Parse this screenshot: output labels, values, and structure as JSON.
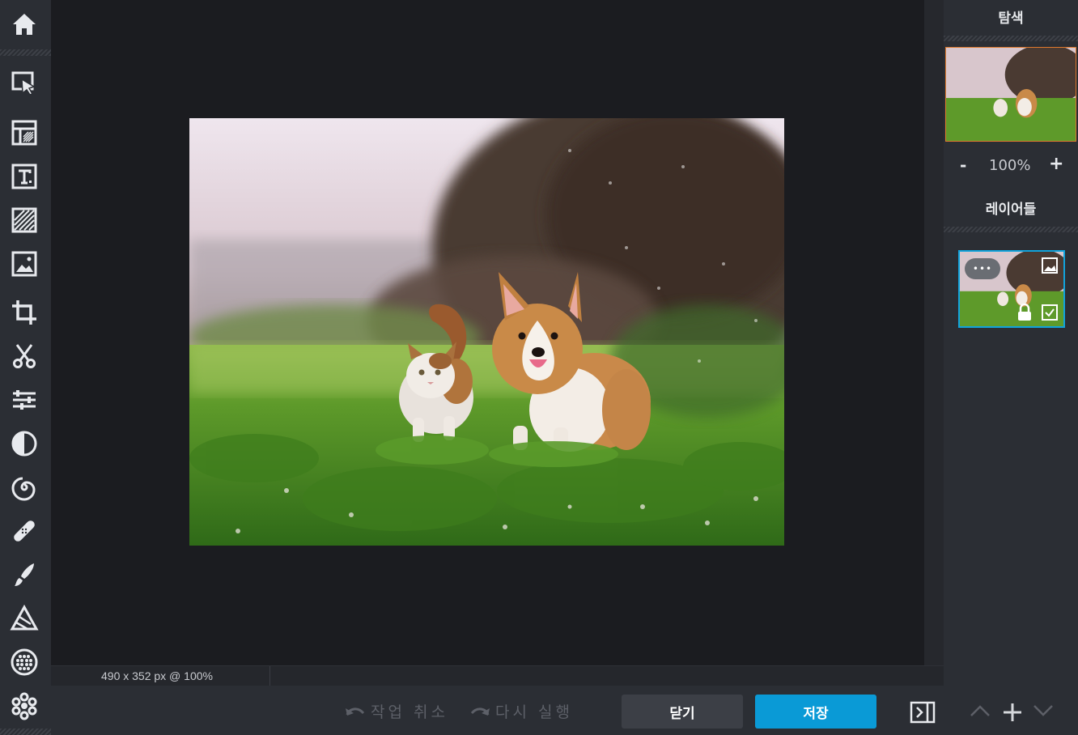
{
  "toolbar": {
    "items": [
      {
        "name": "home-icon"
      },
      {
        "name": "select-arrow-icon"
      },
      {
        "name": "layout-icon"
      },
      {
        "name": "text-icon"
      },
      {
        "name": "texture-icon"
      },
      {
        "name": "image-icon"
      },
      {
        "name": "crop-icon"
      },
      {
        "name": "cut-icon"
      },
      {
        "name": "adjust-sliders-icon"
      },
      {
        "name": "contrast-icon"
      },
      {
        "name": "swirl-icon"
      },
      {
        "name": "bandage-icon"
      },
      {
        "name": "brush-icon"
      },
      {
        "name": "triangle-shape-icon"
      },
      {
        "name": "pattern-dots-icon"
      },
      {
        "name": "flower-icon"
      }
    ]
  },
  "status": {
    "text": "490 x 352 px @ 100%"
  },
  "history": {
    "undo_label": "작업 취소",
    "redo_label": "다시 실행"
  },
  "actions": {
    "close_label": "닫기",
    "save_label": "저장"
  },
  "navigator": {
    "title": "탐색",
    "zoom_level": "100%",
    "zoom_out": "-",
    "zoom_in": "+"
  },
  "layers": {
    "title": "레이어들",
    "more_label": "•••"
  },
  "colors": {
    "accent": "#0a9ad6",
    "nav_frame": "#e07a2e",
    "layer_frame": "#11a3dc"
  }
}
